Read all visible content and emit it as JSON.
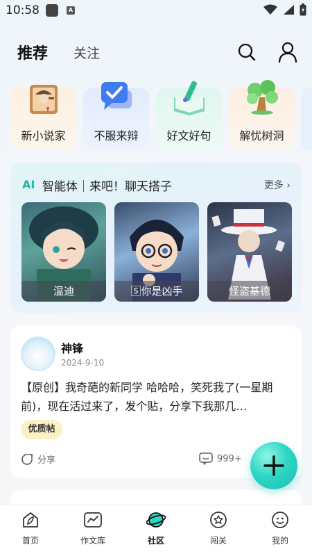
{
  "status": {
    "time": "10:58",
    "a_label": "A"
  },
  "header": {
    "tab_recommend": "推荐",
    "tab_follow": "关注"
  },
  "categories": [
    {
      "label": "新小说家",
      "icon": "detective-book-icon"
    },
    {
      "label": "不服来辩",
      "icon": "check-chat-icon"
    },
    {
      "label": "好文好句",
      "icon": "pen-book-icon"
    },
    {
      "label": "解忧树洞",
      "icon": "tree-icon"
    }
  ],
  "ai_card": {
    "logo": "AI",
    "title": "智能体｜来吧！聊天搭子",
    "more": "更多",
    "characters": [
      {
        "name": "温迪"
      },
      {
        "name": "🅂你是凶手"
      },
      {
        "name": "怪盗基德"
      }
    ]
  },
  "post": {
    "username": "神锋",
    "date": "2024-9-10",
    "text": "【原创】我奇葩的新同学 哈哈哈，笑死我了(一星期前)，现在活过来了，发个贴，分享下我那几…",
    "badge": "优质帖",
    "share_label": "分享",
    "comment_count": "999+"
  },
  "nav": [
    {
      "label": "首页",
      "icon": "home-leaf-icon"
    },
    {
      "label": "作文库",
      "icon": "chart-folder-icon"
    },
    {
      "label": "社区",
      "icon": "planet-icon"
    },
    {
      "label": "闯关",
      "icon": "star-badge-icon"
    },
    {
      "label": "我的",
      "icon": "smiley-face-icon"
    }
  ],
  "colors": {
    "accent": "#1fb7a6",
    "badge_bg": "#fcf1c4"
  }
}
